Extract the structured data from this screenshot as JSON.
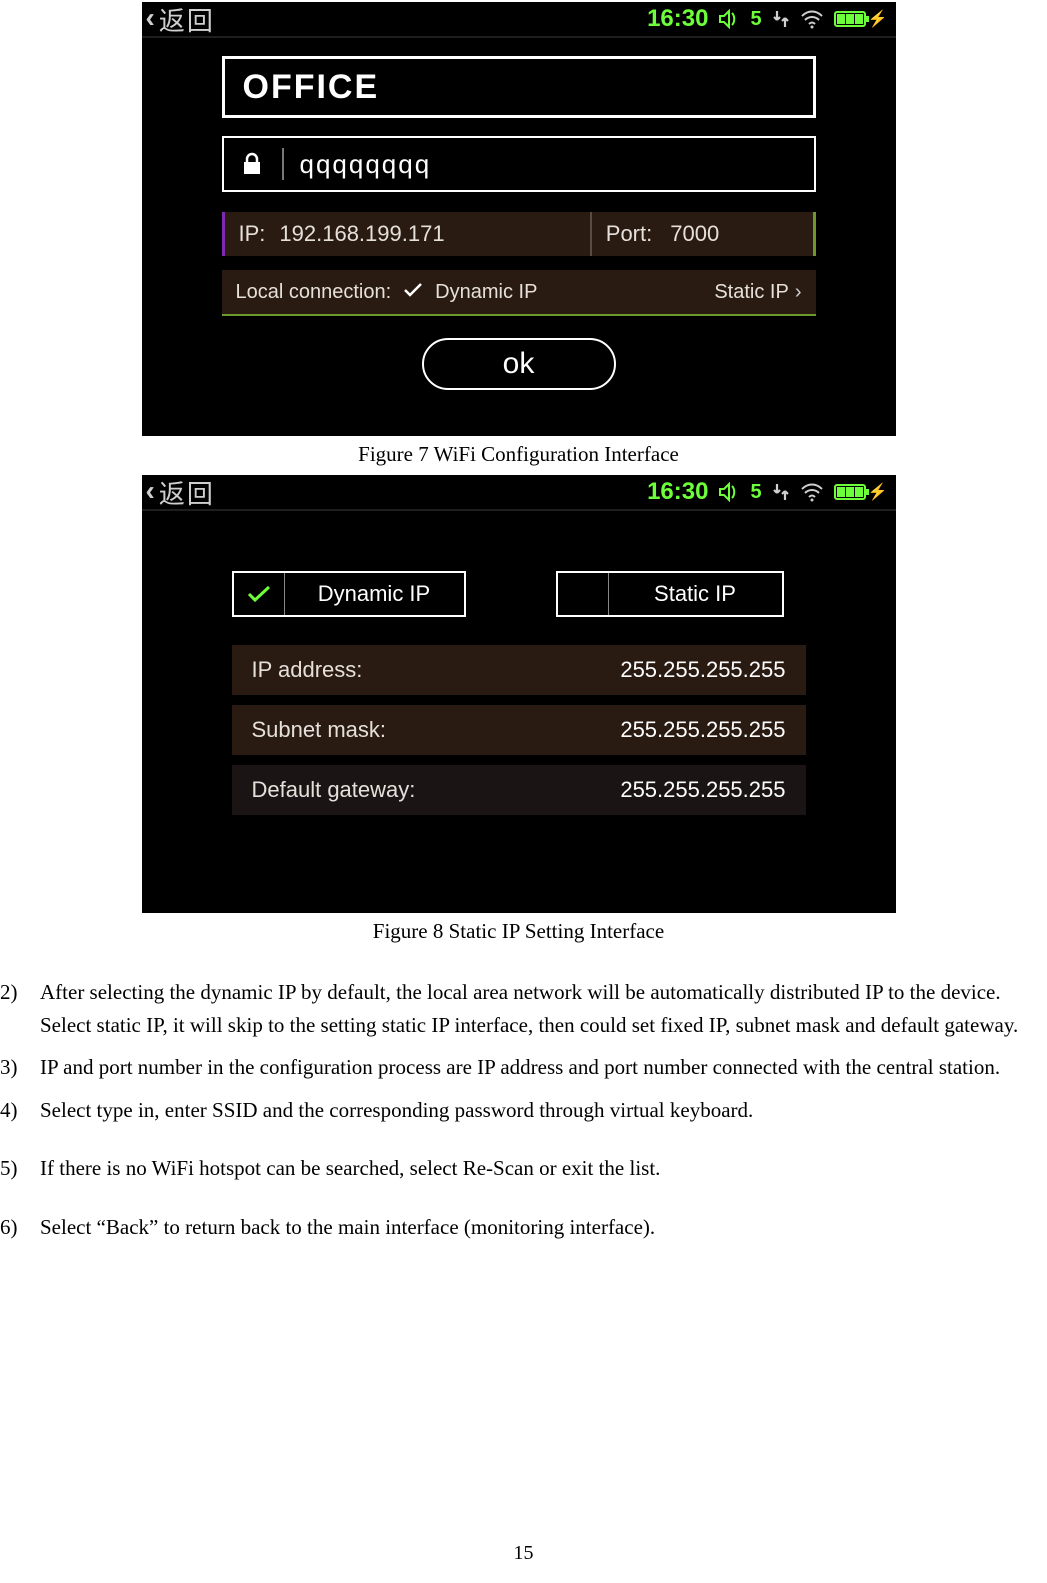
{
  "statusbar": {
    "back_label": "返回",
    "time": "16:30",
    "volume_value": "5"
  },
  "fig7": {
    "ssid": "OFFICE",
    "password": "qqqqqqqq",
    "ip_label": "IP:",
    "ip_value": "192.168.199.171",
    "port_label": "Port:",
    "port_value": "7000",
    "local_label": "Local connection:",
    "dynamic_label": "Dynamic IP",
    "static_label": "Static IP",
    "ok_label": "ok",
    "caption": "Figure 7 WiFi Configuration Interface"
  },
  "fig8": {
    "dynamic_label": "Dynamic IP",
    "static_label": "Static IP",
    "rows": [
      {
        "label": "IP address:",
        "value": "255.255.255.255"
      },
      {
        "label": "Subnet mask:",
        "value": "255.255.255.255"
      },
      {
        "label": "Default gateway:",
        "value": "255.255.255.255"
      }
    ],
    "caption": "Figure 8 Static IP Setting Interface"
  },
  "instructions": {
    "item2_num": "2)",
    "item2": "After selecting the dynamic IP by default, the local area network will be automatically distributed IP to the device. Select static IP, it will skip to the setting static IP interface, then could set fixed IP, subnet mask and default gateway.",
    "item3_num": "3)",
    "item3": "IP and port number in the configuration process are IP address and port number connected with the central station.",
    "item4_num": "4)",
    "item4": "Select type in, enter SSID and the corresponding password through virtual keyboard.",
    "item5_num": "5)",
    "item5": "If there is no WiFi hotspot can be searched, select Re-Scan or exit the list.",
    "item6_num": "6)",
    "item6": "Select “Back” to return back to the main interface (monitoring interface)."
  },
  "page_number": "15"
}
